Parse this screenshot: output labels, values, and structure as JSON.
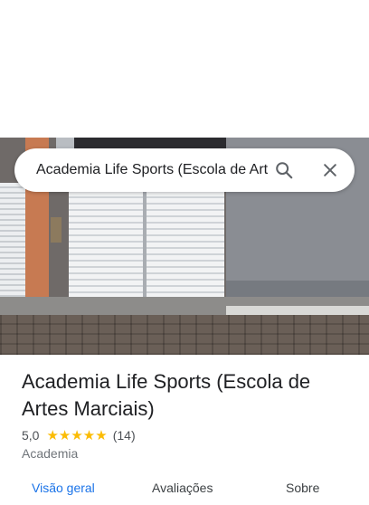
{
  "search": {
    "value": "Academia Life Sports (Escola de Art",
    "search_icon": "search-icon",
    "close_icon": "close-icon"
  },
  "place": {
    "title": "Academia Life Sports (Escola de Artes Marciais)",
    "rating": "5,0",
    "stars": "★★★★★",
    "reviews_count": "(14)",
    "category": "Academia",
    "rating_stars_value": 5
  },
  "tabs": [
    {
      "label": "Visão geral",
      "active": true
    },
    {
      "label": "Avaliações",
      "active": false
    },
    {
      "label": "Sobre",
      "active": false
    }
  ],
  "colors": {
    "accent": "#1a73e8",
    "star": "#fbbc04",
    "text": "#202124",
    "secondary": "#70757a"
  }
}
